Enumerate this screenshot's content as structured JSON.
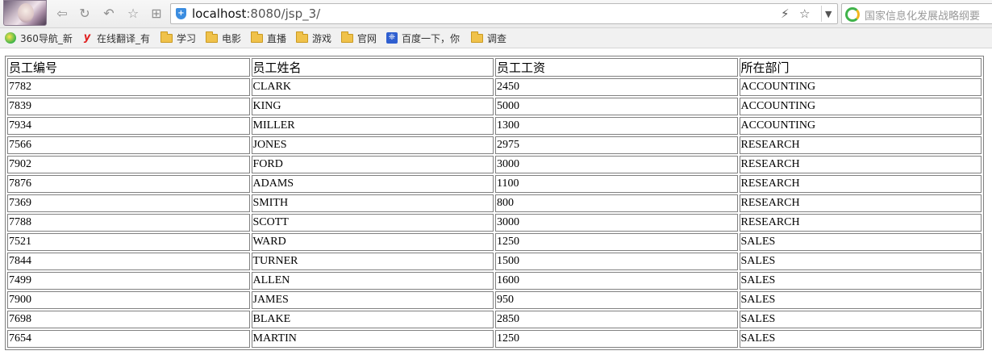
{
  "browser": {
    "url_host": "localhost",
    "url_path": ":8080/jsp_3/",
    "search_placeholder": "国家信息化发展战略纲要",
    "icons": [
      "back-icon",
      "refresh-icon",
      "undo-icon",
      "favorite-icon",
      "apps-icon",
      "lightning-icon",
      "star-icon",
      "dropdown-icon"
    ]
  },
  "bookmarks": [
    {
      "label": "360导航_新",
      "icon": "360-icon"
    },
    {
      "label": "在线翻译_有",
      "icon": "youdao-icon"
    },
    {
      "label": "学习",
      "icon": "folder-icon"
    },
    {
      "label": "电影",
      "icon": "folder-icon"
    },
    {
      "label": "直播",
      "icon": "folder-icon"
    },
    {
      "label": "游戏",
      "icon": "folder-icon"
    },
    {
      "label": "官网",
      "icon": "folder-icon"
    },
    {
      "label": "百度一下，你",
      "icon": "baidu-icon"
    },
    {
      "label": "调查",
      "icon": "folder-icon"
    }
  ],
  "table": {
    "headers": [
      "员工编号",
      "员工姓名",
      "员工工资",
      "所在部门"
    ],
    "rows": [
      [
        "7782",
        "CLARK",
        "2450",
        "ACCOUNTING"
      ],
      [
        "7839",
        "KING",
        "5000",
        "ACCOUNTING"
      ],
      [
        "7934",
        "MILLER",
        "1300",
        "ACCOUNTING"
      ],
      [
        "7566",
        "JONES",
        "2975",
        "RESEARCH"
      ],
      [
        "7902",
        "FORD",
        "3000",
        "RESEARCH"
      ],
      [
        "7876",
        "ADAMS",
        "1100",
        "RESEARCH"
      ],
      [
        "7369",
        "SMITH",
        "800",
        "RESEARCH"
      ],
      [
        "7788",
        "SCOTT",
        "3000",
        "RESEARCH"
      ],
      [
        "7521",
        "WARD",
        "1250",
        "SALES"
      ],
      [
        "7844",
        "TURNER",
        "1500",
        "SALES"
      ],
      [
        "7499",
        "ALLEN",
        "1600",
        "SALES"
      ],
      [
        "7900",
        "JAMES",
        "950",
        "SALES"
      ],
      [
        "7698",
        "BLAKE",
        "2850",
        "SALES"
      ],
      [
        "7654",
        "MARTIN",
        "1250",
        "SALES"
      ]
    ]
  }
}
